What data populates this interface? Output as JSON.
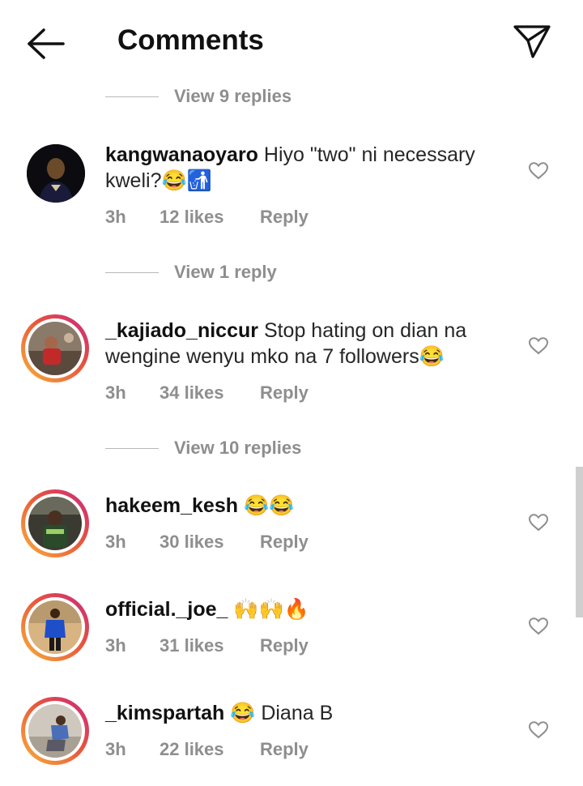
{
  "header": {
    "title": "Comments"
  },
  "replies": [
    {
      "label": "View 9 replies"
    },
    {
      "label": "View 1 reply"
    },
    {
      "label": "View 10 replies"
    }
  ],
  "comments": [
    {
      "username": "kangwanaoyaro",
      "text": "Hiyo \"two\" ni necessary kweli?😂🚮",
      "time": "3h",
      "likes": "12 likes",
      "reply": "Reply"
    },
    {
      "username": "_kajiado_niccur",
      "text": "Stop hating on dian na wengine wenyu mko na 7 followers😂",
      "time": "3h",
      "likes": "34 likes",
      "reply": "Reply"
    },
    {
      "username": "hakeem_kesh",
      "text": "😂😂",
      "time": "3h",
      "likes": "30 likes",
      "reply": "Reply"
    },
    {
      "username": "official._joe_",
      "text": "🙌🙌🔥",
      "time": "3h",
      "likes": "31 likes",
      "reply": "Reply"
    },
    {
      "username": "_kimspartah",
      "text": "😂 Diana B",
      "time": "3h",
      "likes": "22 likes",
      "reply": "Reply"
    }
  ],
  "icons": {
    "back": "arrow-left-icon",
    "send": "paper-plane-icon",
    "like": "heart-outline-icon"
  },
  "colors": {
    "text": "#262626",
    "muted": "#8e8e8e",
    "story_ring_start": "#f8b13b",
    "story_ring_end": "#c8257f"
  }
}
